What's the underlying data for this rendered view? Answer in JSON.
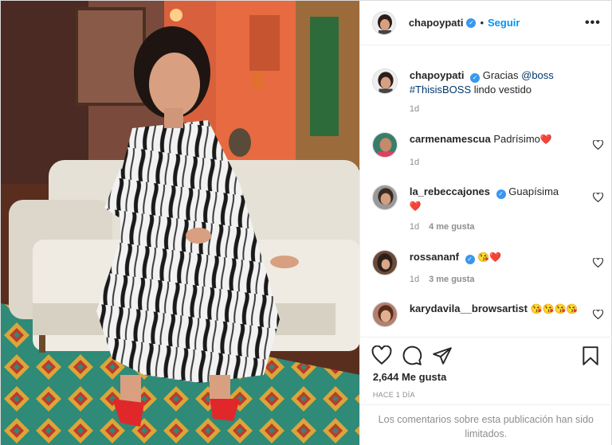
{
  "post": {
    "username": "chapoypati",
    "follow_label": "Seguir",
    "dot": "•",
    "more": "•••"
  },
  "caption": {
    "user": "chapoypati",
    "text_before": "Gracias",
    "mention": "@boss",
    "hashtag": "#ThisisBOSS",
    "text_after": "lindo vestido",
    "time": "1d"
  },
  "comments": [
    {
      "user": "carmenamescua",
      "verified": false,
      "text": "Padrísimo",
      "emoji": "❤️",
      "time": "1d",
      "likes": ""
    },
    {
      "user": "la_rebeccajones",
      "verified": true,
      "text": "Guapísima",
      "emoji": "❤️",
      "time": "1d",
      "likes": "4 me gusta"
    },
    {
      "user": "rossananf",
      "verified": true,
      "text": "",
      "emoji": "😘❤️",
      "time": "1d",
      "likes": "3 me gusta"
    },
    {
      "user": "karydavila__browsartist",
      "verified": false,
      "text": "",
      "emoji": "😘😘😘😘",
      "time": "",
      "likes": ""
    }
  ],
  "footer": {
    "likes": "2,644 Me gusta",
    "time_ago": "HACE 1 DÍA",
    "limited_notice": "Los comentarios sobre esta publicación han sido limitados."
  },
  "icons": {
    "like": "heart-outline-icon",
    "comment": "speech-bubble-icon",
    "share": "paper-plane-icon",
    "save": "bookmark-icon",
    "verified": "verified-badge-icon"
  },
  "colors": {
    "link_blue": "#0095f6",
    "verified": "#3897f0",
    "muted": "#8e8e8e",
    "text": "#262626",
    "heart_red": "#ed4956"
  }
}
